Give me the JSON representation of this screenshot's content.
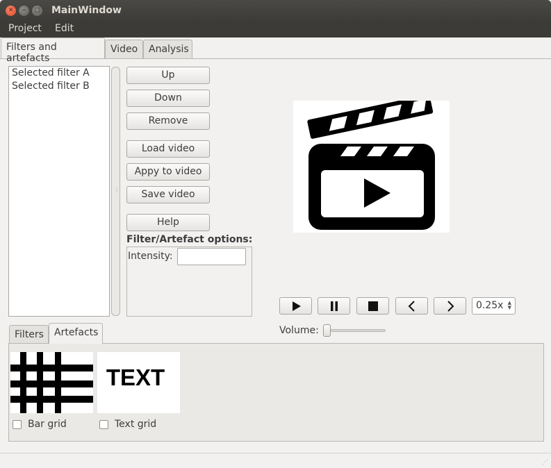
{
  "window": {
    "title": "MainWindow"
  },
  "menu": {
    "items": [
      "Project",
      "Edit"
    ]
  },
  "main_tabs": [
    "Filters and artefacts",
    "Video",
    "Analysis"
  ],
  "selected_filters": [
    "Selected filter A",
    "Selected filter B"
  ],
  "buttons": {
    "up": "Up",
    "down": "Down",
    "remove": "Remove",
    "load_video": "Load video",
    "apply_to_video": "Appy to video",
    "save_video": "Save video",
    "help": "Help"
  },
  "options": {
    "title": "Filter/Artefact options:",
    "intensity_label": "Intensity:",
    "intensity_value": ""
  },
  "playback": {
    "speed": "0.25x",
    "volume_label": "Volume:",
    "volume_level": 0
  },
  "bottom_tabs": [
    "Filters",
    "Artefacts"
  ],
  "artefacts": [
    {
      "label": "Bar grid",
      "checked": false
    },
    {
      "label": "Text grid",
      "checked": false,
      "thumb_text": "TEXT"
    }
  ]
}
